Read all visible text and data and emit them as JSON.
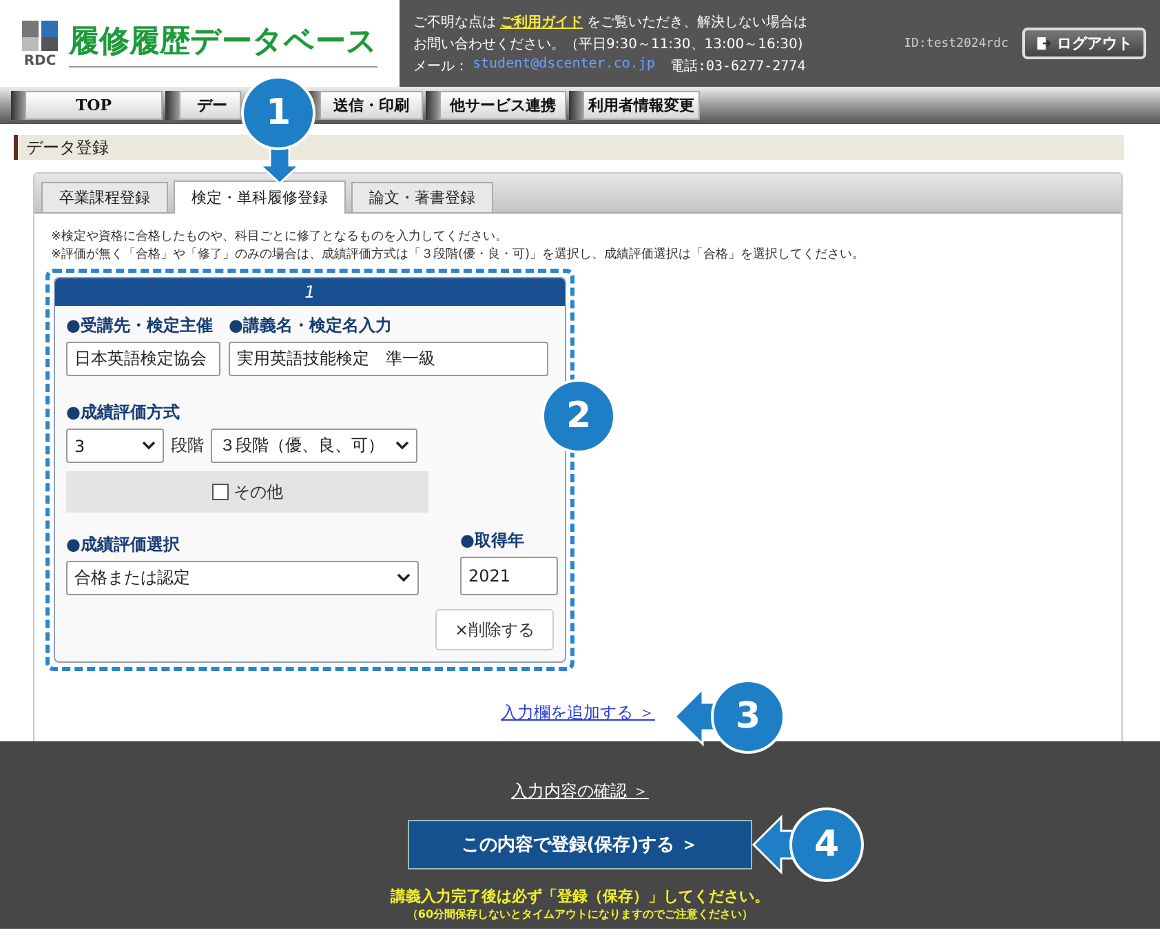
{
  "header": {
    "title": "履修履歴データベース",
    "logo_caption": "RDC",
    "info": {
      "prefix": "ご不明な点は",
      "guide_link": "ご利用ガイド",
      "suffix": "をご覧いただき、解決しない場合は",
      "line2": "お問い合わせください。（平日9:30～11:30、13:00～16:30)",
      "mail_label": "メール：",
      "email": "student@dscenter.co.jp",
      "phone": "電話:03-6277-2774"
    },
    "user_id": "ID:test2024rdc",
    "logout": "ログアウト"
  },
  "nav": [
    {
      "label": "TOP"
    },
    {
      "label": "デー"
    },
    {
      "label": "送信・印刷"
    },
    {
      "label": "他サービス連携"
    },
    {
      "label": "利用者情報変更"
    }
  ],
  "section_title": "データ登録",
  "tabs": [
    {
      "label": "卒業課程登録",
      "selected": false
    },
    {
      "label": "検定・単科履修登録",
      "selected": true
    },
    {
      "label": "論文・著書登録",
      "selected": false
    }
  ],
  "notes": [
    "※検定や資格に合格したものや、科目ごとに修了となるものを入力してください。",
    "※評価が無く「合格」や「修了」のみの場合は、成績評価方式は「３段階(優・良・可)」を選択し、成績評価選択は「合格」を選択してください。"
  ],
  "entry": {
    "number": "1",
    "provider_label": "●受講先・検定主催",
    "provider": "日本英語検定協会",
    "course_label": "●講義名・検定名入力",
    "course": "実用英語技能検定　準一級",
    "method_label": "●成績評価方式",
    "scale": "3",
    "scale_unit": "段階",
    "method": "３段階（優、良、可）",
    "other": {
      "label": "その他",
      "checked": false
    },
    "grade_label": "●成績評価選択",
    "grade": "合格または認定",
    "year_label": "●取得年",
    "year": "2021",
    "delete": "×削除する"
  },
  "add_link": "入力欄を追加する ＞",
  "footer": {
    "confirm_link": "入力内容の確認 ＞",
    "save_button": "この内容で登録(保存)する ＞",
    "warning": "講義入力完了後は必ず「登録（保存）」してください。",
    "notice": "（60分間保存しないとタイムアウトになりますのでご注意ください）"
  },
  "callouts": [
    {
      "number": "1",
      "kind": "down"
    },
    {
      "number": "2",
      "kind": "plain"
    },
    {
      "number": "3",
      "kind": "left"
    },
    {
      "number": "4",
      "kind": "left"
    }
  ]
}
